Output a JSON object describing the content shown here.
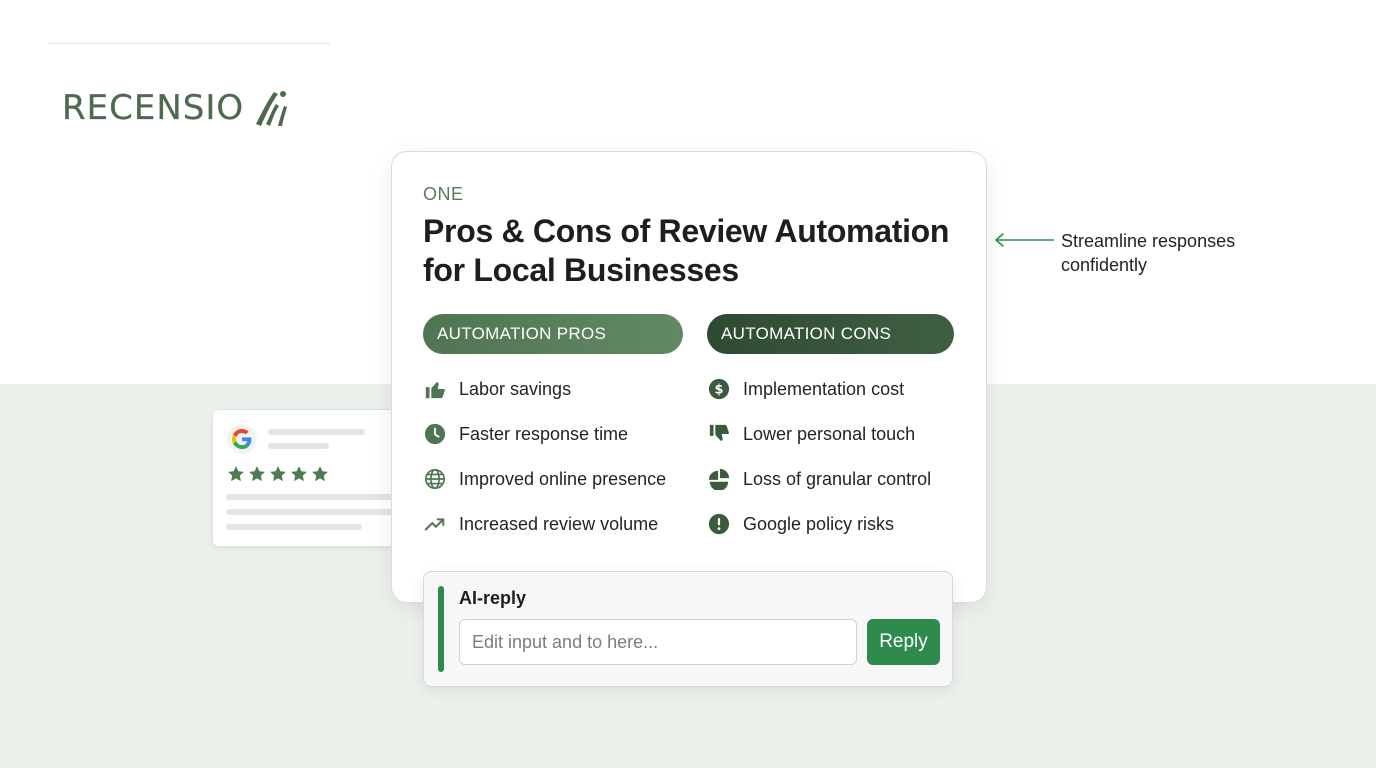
{
  "brand": {
    "name": "RECENSIO",
    "color": "#4c6a4e"
  },
  "review_card": {
    "stars": 5,
    "icon": "google-logo-icon",
    "star_color": "#4f7a52"
  },
  "main": {
    "eyebrow": "ONE",
    "title": "Pros & Cons of Review Automation for Local Businesses",
    "pros": {
      "label": "AUTOMATION PROS",
      "items": [
        {
          "label": "Labor savings",
          "icon": "thumbs-up-icon"
        },
        {
          "label": "Faster response time",
          "icon": "clock-icon"
        },
        {
          "label": "Improved online presence",
          "icon": "globe-icon"
        },
        {
          "label": "Increased review volume",
          "icon": "trending-up-icon"
        }
      ]
    },
    "cons": {
      "label": "AUTOMATION CONS",
      "items": [
        {
          "label": "Implementation cost",
          "icon": "dollar-circle-icon"
        },
        {
          "label": "Lower personal touch",
          "icon": "thumbs-down-icon"
        },
        {
          "label": "Loss of granular control",
          "icon": "pie-slice-icon"
        },
        {
          "label": "Google policy risks",
          "icon": "alert-circle-icon"
        }
      ]
    }
  },
  "reply": {
    "title": "AI-reply",
    "placeholder": "Edit input and to here...",
    "button_label": "Reply",
    "accent": "#2f8a4d"
  },
  "annotation": {
    "text": "Streamline responses confidently",
    "color": "#2f8a4d"
  }
}
